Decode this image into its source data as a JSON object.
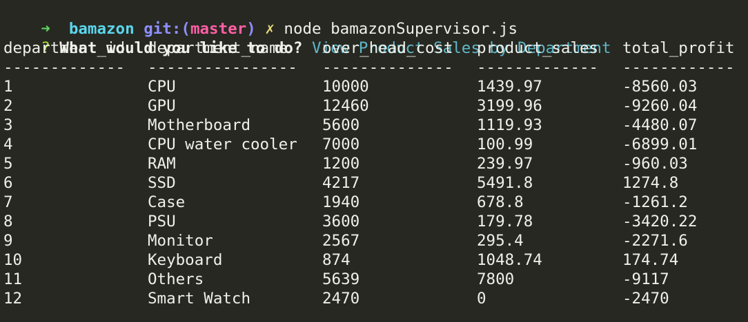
{
  "prompt": {
    "arrow": "➜",
    "repo": "bamazon",
    "git_label": "git:(",
    "branch": "master",
    "git_close": ")",
    "dirty_mark": "✗",
    "command": "node bamazonSupervisor.js"
  },
  "question_line": {
    "qmark": "?",
    "question": "What would you like to do?",
    "answer": "View Product Sales by Department"
  },
  "table": {
    "headers": [
      "department_id",
      "department_name",
      "over_head_cost",
      "product_sales",
      "total_profit"
    ],
    "separators": [
      "-------------",
      "----------------",
      "--------------",
      "-------------",
      "------------"
    ],
    "rows": [
      [
        "1",
        "CPU",
        "10000",
        "1439.97",
        "-8560.03"
      ],
      [
        "2",
        "GPU",
        "12460",
        "3199.96",
        "-9260.04"
      ],
      [
        "3",
        "Motherboard",
        "5600",
        "1119.93",
        "-4480.07"
      ],
      [
        "4",
        "CPU water cooler",
        "7000",
        "100.99",
        "-6899.01"
      ],
      [
        "5",
        "RAM",
        "1200",
        "239.97",
        "-960.03"
      ],
      [
        "6",
        "SSD",
        "4217",
        "5491.8",
        "1274.8"
      ],
      [
        "7",
        "Case",
        "1940",
        "678.8",
        "-1261.2"
      ],
      [
        "8",
        "PSU",
        "3600",
        "179.78",
        "-3420.22"
      ],
      [
        "9",
        "Monitor",
        "2567",
        "295.4",
        "-2271.6"
      ],
      [
        "10",
        "Keyboard",
        "874",
        "1048.74",
        "174.74"
      ],
      [
        "11",
        "Others",
        "5639",
        "7800",
        "-9117"
      ],
      [
        "12",
        "Smart Watch",
        "2470",
        "0",
        "-2470"
      ]
    ]
  },
  "colors": {
    "background": "#272822",
    "text": "#f0f0ea",
    "arrow": "#5fd75f",
    "repo": "#5ad7ee",
    "git": "#8f8fff",
    "branch": "#ff5fa5",
    "dirty": "#e6db74",
    "answer": "#5fb8c8",
    "qmark": "#a6e22e"
  }
}
